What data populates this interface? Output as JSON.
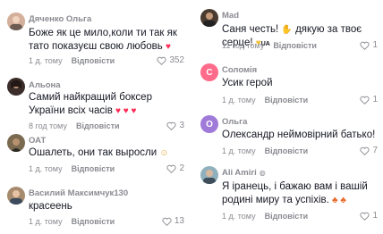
{
  "left": [
    {
      "name": "Дяченко Ольга",
      "text": "Боже як це мило,коли ти так як тато показуєш свою любовь",
      "suffix": "♥",
      "time": "1 д. тому",
      "reply": "Відповісти",
      "likes": "352",
      "avatar_color": "#c9a18a"
    },
    {
      "name": "Альона",
      "text": "Самий найкращий боксер України всіх часів",
      "suffix": "♥ ♥ ♥",
      "time": "8 год тому",
      "reply": "Відповісти",
      "likes": "3",
      "avatar_color": "#4b3a34"
    },
    {
      "name": "ОАТ",
      "text": "Ошалеть, они так выросли",
      "suffix": "☺",
      "time": "1 д. тому",
      "reply": "Відповісти",
      "likes": "2",
      "avatar_color": "#6b5a3c"
    },
    {
      "name": "Василий Максимчук130",
      "text": "красеень",
      "suffix": "",
      "time": "1 д. тому",
      "reply": "Відповісти",
      "likes": "13",
      "avatar_color": "#8b6e52"
    }
  ],
  "right": [
    {
      "name": "Mad",
      "sub": "",
      "text": "Саня честь!",
      "suffix": "дякую за твоє серце!",
      "suffix2": "UA",
      "time": "11 год тому",
      "reply": "Відповісти",
      "likes": "1",
      "avatar_color": "#5a4a3a"
    },
    {
      "name": "Соломія",
      "letter": "C",
      "text": "Усик герой",
      "time": "1 д. тому",
      "reply": "Відповісти",
      "likes": "1",
      "avatar_color": "#ff6b8a"
    },
    {
      "name": "Ольга",
      "letter": "O",
      "text": "Олександр неймовірний батько!",
      "time": "1 д. тому",
      "reply": "Відповісти",
      "likes": "7",
      "avatar_color": "#a07ad8"
    },
    {
      "name": "Ali Amiri",
      "sub": "🌐",
      "text": "Я іранець, і бажаю вам і вашій родині миру та успіхів.",
      "suffix": "♣ ♣",
      "time": "1 д. тому",
      "reply": "Відповісти",
      "likes": "1",
      "avatar_color": "#7a9aa8"
    }
  ]
}
